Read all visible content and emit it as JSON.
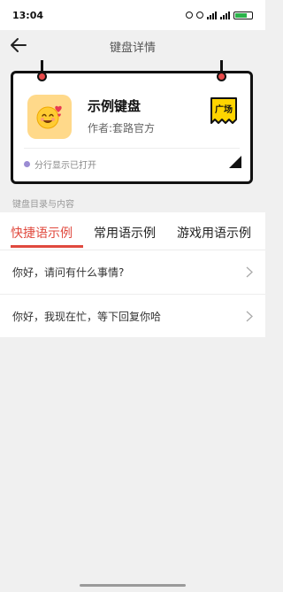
{
  "status_bar": {
    "time": "13:04"
  },
  "header": {
    "title": "键盘详情"
  },
  "keyboard": {
    "name": "示例键盘",
    "author": "作者:套路官方",
    "badge": "广场",
    "split_status": "分行显示已打开"
  },
  "section": {
    "title": "键盘目录与内容"
  },
  "tabs": [
    {
      "label": "快捷语示例",
      "active": true
    },
    {
      "label": "常用语示例",
      "active": false
    },
    {
      "label": "游戏用语示例",
      "active": false
    }
  ],
  "phrases": [
    {
      "text": "你好，请问有什么事情?"
    },
    {
      "text": "你好，我现在忙，等下回复你哈"
    }
  ],
  "colors": {
    "accent": "#e0493e",
    "badge_yellow": "#ffd400",
    "pin_red": "#e84a4a",
    "purple_dot": "#9b8cd3",
    "icon_bg": "#ffd98a"
  }
}
